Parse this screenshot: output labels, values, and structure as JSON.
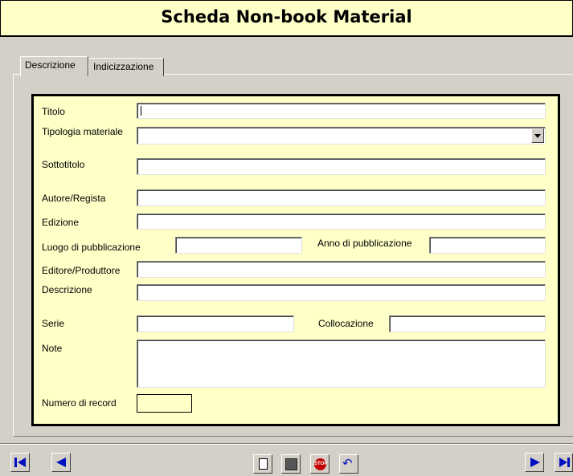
{
  "window": {
    "title": "Scheda Non-book Material"
  },
  "tabs": [
    {
      "label": "Descrizione",
      "active": true
    },
    {
      "label": "Indicizzazione",
      "active": false
    }
  ],
  "form": {
    "titolo": {
      "label": "Titolo",
      "value": ""
    },
    "tipologia": {
      "label": "Tipologia materiale",
      "value": ""
    },
    "sottotitolo": {
      "label": "Sottotitolo",
      "value": ""
    },
    "autore": {
      "label": "Autore/Regista",
      "value": ""
    },
    "edizione": {
      "label": "Edizione",
      "value": ""
    },
    "luogo": {
      "label": "Luogo di pubblicazione",
      "value": ""
    },
    "anno": {
      "label": "Anno di pubblicazione",
      "value": ""
    },
    "editore": {
      "label": "Editore/Produttore",
      "value": ""
    },
    "descrizione": {
      "label": "Descrizione",
      "value": ""
    },
    "serie": {
      "label": "Serie",
      "value": ""
    },
    "collocazione": {
      "label": "Collocazione",
      "value": ""
    },
    "note": {
      "label": "Note",
      "value": ""
    },
    "record": {
      "label": "Numero di record",
      "value": ""
    }
  },
  "navigation": {
    "icons": [
      "first-record-icon",
      "previous-record-icon",
      "new-record-icon",
      "save-record-icon",
      "stop-icon",
      "undo-icon",
      "next-record-icon",
      "last-record-icon"
    ],
    "stop_icon_text": "STOP"
  },
  "colors": {
    "form_background": "#ffffc8",
    "nav_arrow": "#0010c0",
    "window": "#d4d0c8"
  }
}
